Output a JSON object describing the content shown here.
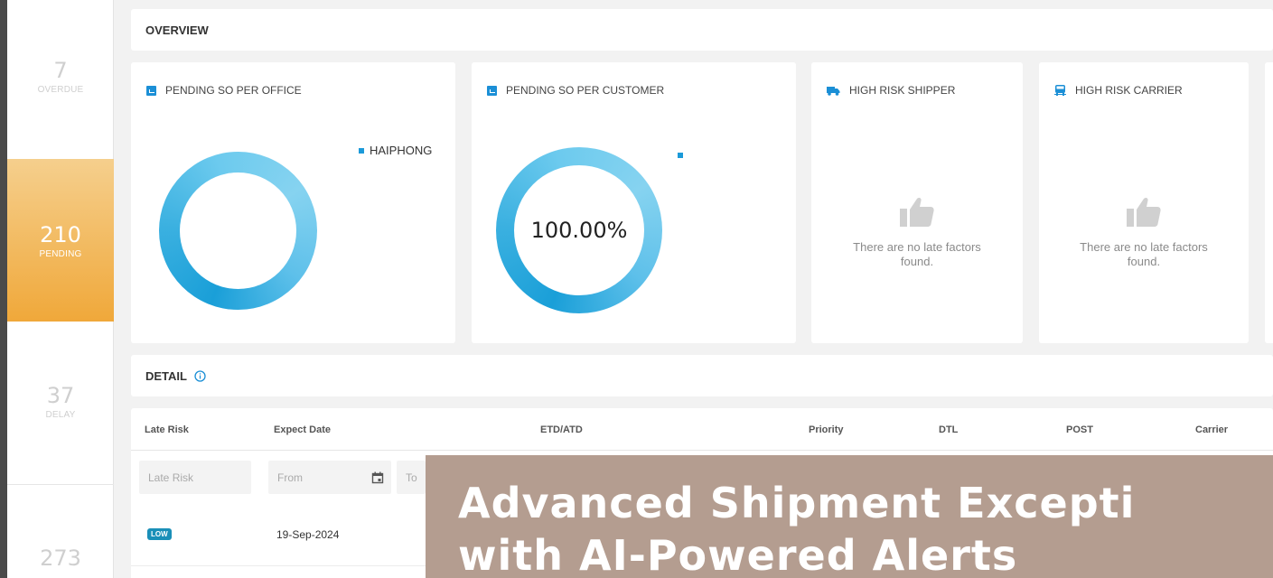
{
  "sidebar": {
    "stats": [
      {
        "value": "7",
        "label": "OVERDUE"
      },
      {
        "value": "210",
        "label": "PENDING"
      },
      {
        "value": "37",
        "label": "DELAY"
      },
      {
        "value": "273",
        "label": ""
      }
    ]
  },
  "overview": {
    "title": "OVERVIEW",
    "cards": [
      {
        "title": "PENDING SO PER OFFICE",
        "legend": "HAIPHONG",
        "center": ""
      },
      {
        "title": "PENDING SO PER CUSTOMER",
        "legend": "",
        "center": "100.00%"
      },
      {
        "title": "HIGH RISK SHIPPER",
        "empty_message": "There are no late factors found."
      },
      {
        "title": "HIGH RISK CARRIER",
        "empty_message": "There are no late factors found."
      }
    ]
  },
  "detail": {
    "title": "DETAIL",
    "columns": [
      "Late Risk",
      "Expect Date",
      "ETD/ATD",
      "Priority",
      "DTL",
      "POST",
      "Carrier"
    ],
    "filters": {
      "late_risk_placeholder": "Late Risk",
      "from_placeholder": "From",
      "to_placeholder": "To"
    },
    "rows": [
      {
        "late_risk": "LOW",
        "expect_date": "19-Sep-2024"
      }
    ]
  },
  "banner": {
    "line1": "Advanced Shipment Excepti",
    "line2": "with AI-Powered Alerts"
  },
  "colors": {
    "accent": "#1b8fd6",
    "pending_active": "#f0a83a",
    "badge_low": "#1a8fb8",
    "banner_bg": "#b49d90"
  }
}
